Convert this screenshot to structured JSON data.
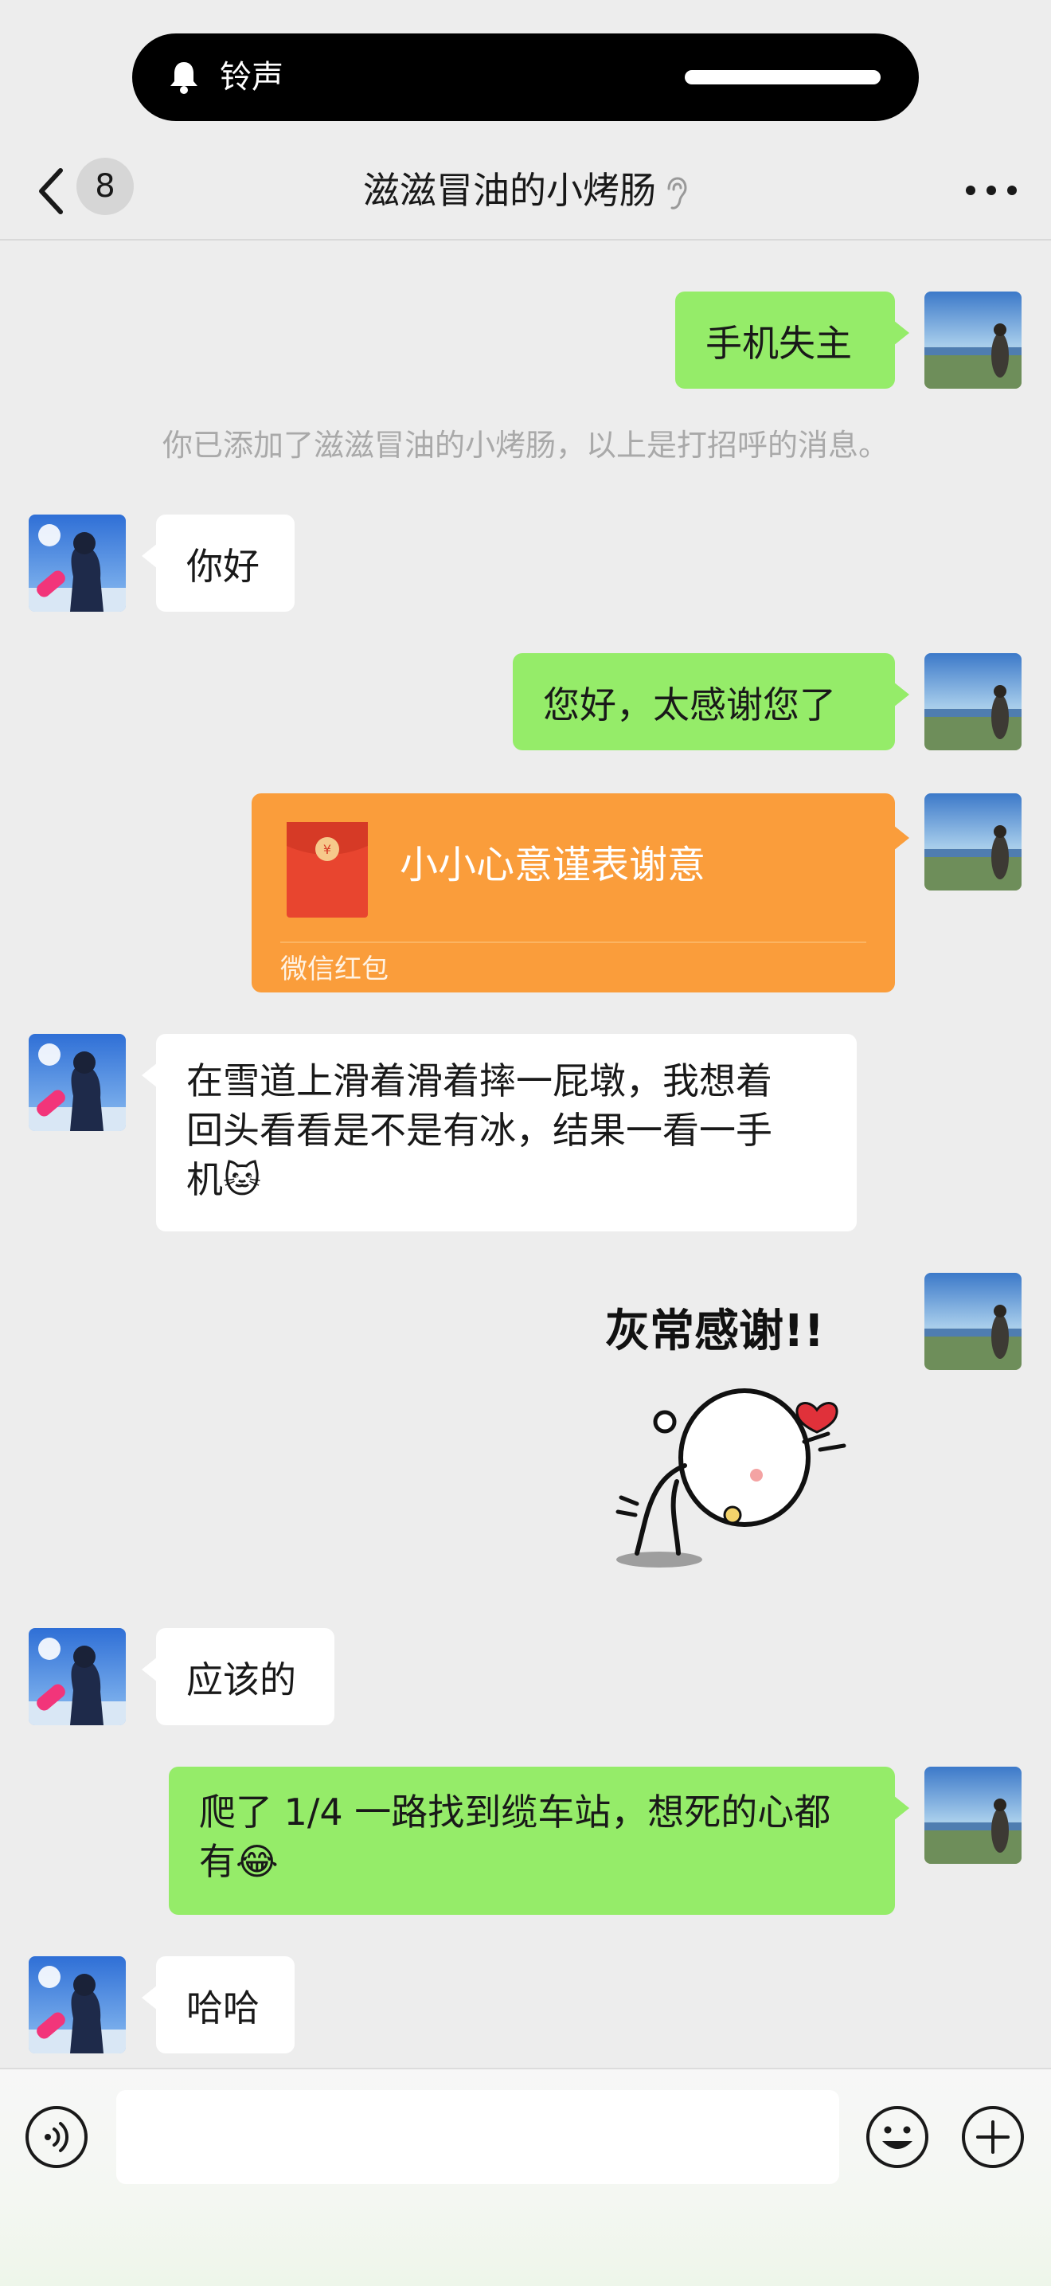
{
  "status": {
    "ringer_label": "铃声"
  },
  "nav": {
    "back_badge": "8",
    "title": "滋滋冒油的小烤肠"
  },
  "system_message": "你已添加了滋滋冒油的小烤肠，以上是打招呼的消息。",
  "messages": [
    {
      "text": "手机失主"
    },
    {
      "text": "你好"
    },
    {
      "text": "您好，太感谢您了"
    },
    {
      "text": "小小心意谨表谢意",
      "footer": "微信红包"
    },
    {
      "line1": "在雪道上滑着滑着摔一屁墩，我想着",
      "line2": "回头看看是不是有冰，结果一看一手",
      "line3": "机🐱"
    },
    {
      "sticker_text": "灰常感谢!!"
    },
    {
      "text": "应该的"
    },
    {
      "line1": "爬了 1/4 一路找到缆车站，想死的心都",
      "line2": "有😂"
    },
    {
      "text": "哈哈"
    }
  ],
  "input": {
    "placeholder": ""
  },
  "colors": {
    "background": "#EDEDED",
    "outgoing_bubble": "#95EC69",
    "incoming_bubble": "#FFFFFF",
    "red_packet": "#FA9D3B"
  },
  "icons": [
    "bell-icon",
    "back-chevron-icon",
    "ear-icon",
    "more-icon",
    "red-envelope-icon",
    "voice-icon",
    "emoji-icon",
    "plus-icon"
  ]
}
